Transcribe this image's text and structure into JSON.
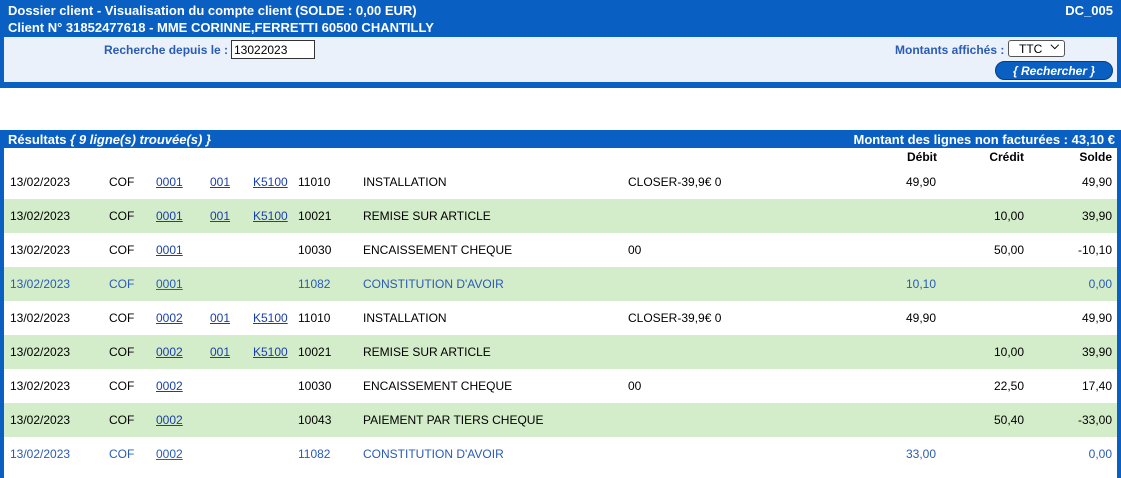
{
  "header": {
    "title": "Dossier client - Visualisation du compte client (SOLDE : 0,00 EUR)",
    "client": "Client N° 31852477618 - MME CORINNE,FERRETTI 60500 CHANTILLY",
    "code": "DC_005"
  },
  "search": {
    "label": "Recherche depuis le :",
    "date_value": "13022023",
    "amount_label": "Montants affichés :",
    "amount_selected": "TTC",
    "button_label": "{ Rechercher }"
  },
  "results": {
    "title": "Résultats",
    "count_text": "{ 9 ligne(s) trouvée(s) }",
    "unbilled_text": "Montant des lignes non facturées : 43,10 €",
    "columns": {
      "debit": "Débit",
      "credit": "Crédit",
      "solde": "Solde"
    },
    "rows": [
      {
        "date": "13/02/2023",
        "type": "COF",
        "ref": "0001",
        "sub": "001",
        "code": "K5100",
        "num": "11010",
        "label": "INSTALLATION",
        "info": "CLOSER-39,9€ 0",
        "debit": "49,90",
        "credit": "",
        "solde": "49,90"
      },
      {
        "date": "13/02/2023",
        "type": "COF",
        "ref": "0001",
        "sub": "001",
        "code": "K5100",
        "num": "10021",
        "label": "REMISE SUR ARTICLE",
        "info": "",
        "debit": "",
        "credit": "10,00",
        "solde": "39,90"
      },
      {
        "date": "13/02/2023",
        "type": "COF",
        "ref": "0001",
        "sub": "",
        "code": "",
        "num": "10030",
        "label": "ENCAISSEMENT CHEQUE",
        "info": "00",
        "debit": "",
        "credit": "50,00",
        "solde": "-10,10"
      },
      {
        "date": "13/02/2023",
        "type": "COF",
        "ref": "0001",
        "sub": "",
        "code": "",
        "num": "11082",
        "label": "CONSTITUTION D'AVOIR",
        "info": "",
        "debit": "10,10",
        "credit": "",
        "solde": "0,00"
      },
      {
        "date": "13/02/2023",
        "type": "COF",
        "ref": "0002",
        "sub": "001",
        "code": "K5100",
        "num": "11010",
        "label": "INSTALLATION",
        "info": "CLOSER-39,9€ 0",
        "debit": "49,90",
        "credit": "",
        "solde": "49,90"
      },
      {
        "date": "13/02/2023",
        "type": "COF",
        "ref": "0002",
        "sub": "001",
        "code": "K5100",
        "num": "10021",
        "label": "REMISE SUR ARTICLE",
        "info": "",
        "debit": "",
        "credit": "10,00",
        "solde": "39,90"
      },
      {
        "date": "13/02/2023",
        "type": "COF",
        "ref": "0002",
        "sub": "",
        "code": "",
        "num": "10030",
        "label": "ENCAISSEMENT CHEQUE",
        "info": "00",
        "debit": "",
        "credit": "22,50",
        "solde": "17,40"
      },
      {
        "date": "13/02/2023",
        "type": "COF",
        "ref": "0002",
        "sub": "",
        "code": "",
        "num": "10043",
        "label": "PAIEMENT PAR TIERS CHEQUE",
        "info": "",
        "debit": "",
        "credit": "50,40",
        "solde": "-33,00"
      },
      {
        "date": "13/02/2023",
        "type": "COF",
        "ref": "0002",
        "sub": "",
        "code": "",
        "num": "11082",
        "label": "CONSTITUTION D'AVOIR",
        "info": "",
        "debit": "33,00",
        "credit": "",
        "solde": "0,00"
      }
    ]
  },
  "colors": {
    "header_blue": "#0a5fc3",
    "row_green": "#d3ecc9",
    "label_blue": "#2a5bb5"
  }
}
